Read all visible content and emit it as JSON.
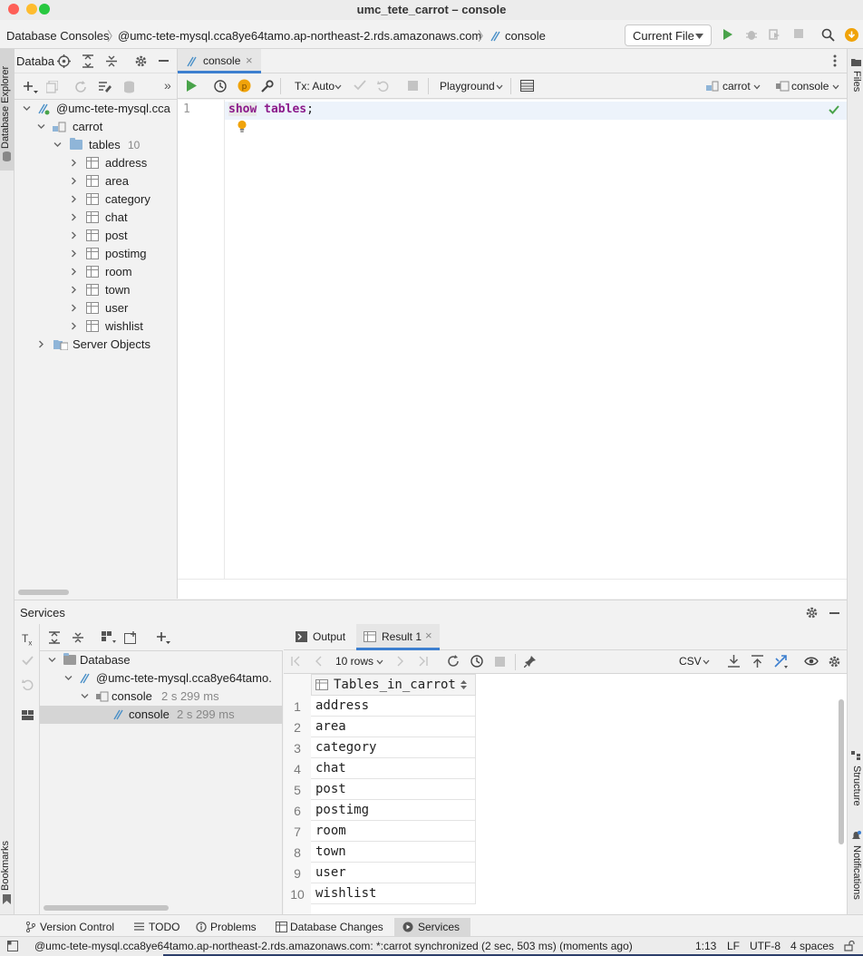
{
  "window": {
    "title": "umc_tete_carrot – console"
  },
  "nav": {
    "crumbs": [
      "Database Consoles",
      "@umc-tete-mysql.cca8ye64tamo.ap-northeast-2.rds.amazonaws.com",
      "console"
    ],
    "run_config": "Current File"
  },
  "left_stripe": {
    "database_explorer": "Database Explorer",
    "bookmarks": "Bookmarks"
  },
  "right_stripe": {
    "files": "Files",
    "structure": "Structure",
    "notifications": "Notifications"
  },
  "db_explorer": {
    "title": "Databa",
    "tree": {
      "connection": "@umc-tete-mysql.cca",
      "schema": "carrot",
      "tables_folder": "tables",
      "tables_count": "10",
      "tables": [
        "address",
        "area",
        "category",
        "chat",
        "post",
        "postimg",
        "room",
        "town",
        "user",
        "wishlist"
      ],
      "server_objects": "Server Objects"
    }
  },
  "editor": {
    "tab_label": "console",
    "tx_mode": "Tx: Auto",
    "playground": "Playground",
    "schema_selector": "carrot",
    "session_selector": "console",
    "line_number": "1",
    "code_keyword1": "show",
    "code_keyword2": "tables",
    "code_punct": ";"
  },
  "services": {
    "title": "Services",
    "tree": {
      "root": "Database",
      "connection": "@umc-tete-mysql.cca8ye64tamo.",
      "session": "console",
      "session_time": "2 s 299 ms",
      "query": "console",
      "query_time": "2 s 299 ms"
    },
    "tabs": {
      "output": "Output",
      "result": "Result 1"
    },
    "result_tools": {
      "rows": "10 rows",
      "export_format": "CSV"
    },
    "grid": {
      "column": "Tables_in_carrot",
      "rows": [
        "address",
        "area",
        "category",
        "chat",
        "post",
        "postimg",
        "room",
        "town",
        "user",
        "wishlist"
      ]
    }
  },
  "bottom_bar": {
    "version_control": "Version Control",
    "todo": "TODO",
    "problems": "Problems",
    "database_changes": "Database Changes",
    "services": "Services"
  },
  "status_bar": {
    "message": "@umc-tete-mysql.cca8ye64tamo.ap-northeast-2.rds.amazonaws.com: *:carrot synchronized (2 sec, 503 ms) (moments ago)",
    "position": "1:13",
    "line_sep": "LF",
    "encoding": "UTF-8",
    "indent": "4 spaces"
  },
  "colors": {
    "accent": "#3d7fcf",
    "run_green": "#49a34a",
    "keyword": "#0033b3",
    "warning_orange": "#f0a30a"
  }
}
